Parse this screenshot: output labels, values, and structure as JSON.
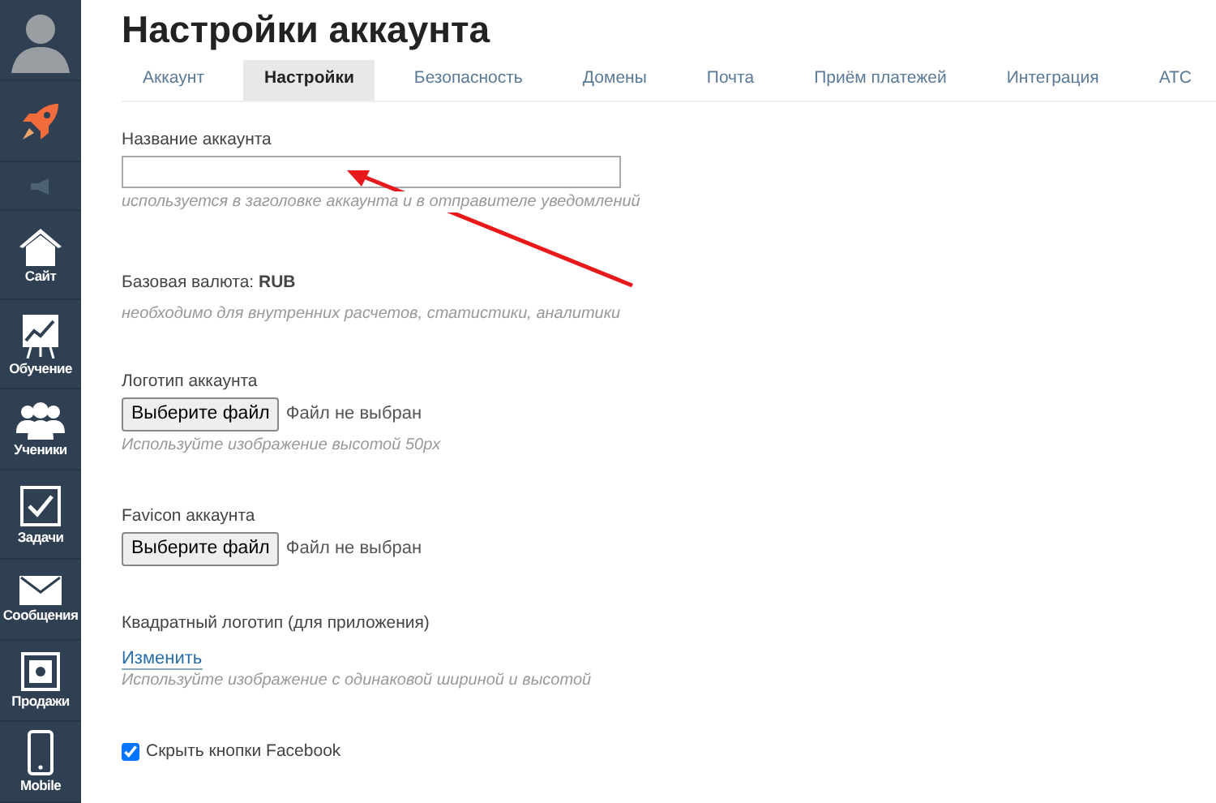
{
  "sidebar": {
    "items": [
      {
        "kind": "avatar"
      },
      {
        "kind": "rocket"
      },
      {
        "kind": "megaphone"
      },
      {
        "kind": "house",
        "label": "Сайт"
      },
      {
        "kind": "chart",
        "label": "Обучение"
      },
      {
        "kind": "people",
        "label": "Ученики"
      },
      {
        "kind": "task",
        "label": "Задачи"
      },
      {
        "kind": "mail",
        "label": "Сообщения"
      },
      {
        "kind": "safe",
        "label": "Продажи"
      },
      {
        "kind": "phone",
        "label": "Mobile"
      }
    ]
  },
  "title": "Настройки аккаунта",
  "tabs": [
    {
      "label": "Аккаунт",
      "selected": false
    },
    {
      "label": "Настройки",
      "selected": true
    },
    {
      "label": "Безопасность",
      "selected": false
    },
    {
      "label": "Домены",
      "selected": false
    },
    {
      "label": "Почта",
      "selected": false
    },
    {
      "label": "Приём платежей",
      "selected": false
    },
    {
      "label": "Интеграция",
      "selected": false
    },
    {
      "label": "АТС",
      "selected": false
    }
  ],
  "fields": [
    {
      "kind": "text",
      "label": "Название аккаунта",
      "hint": "используется в заголовке аккаунта и в отправителе уведомлений"
    },
    {
      "kind": "info",
      "label": "Базовая валюта: **RUB**",
      "hint": "необходимо для внутренних расчетов, статистики, аналитики"
    },
    {
      "kind": "file",
      "label": "Логотип аккаунта",
      "button": "Выберите файл",
      "status": "Файл не выбран",
      "hint": "Используйте изображение высотой 50px"
    },
    {
      "kind": "file",
      "label": "Favicon аккаунта",
      "button": "Выберите файл",
      "status": "Файл не выбран"
    },
    {
      "kind": "link",
      "label": "Квадратный логотип (для приложения)",
      "link": "Изменить",
      "hint": "Используйте изображение с одинаковой шириной и высотой"
    },
    {
      "kind": "checkbox",
      "label": "Скрыть кнопки Facebook",
      "checked": true
    }
  ]
}
